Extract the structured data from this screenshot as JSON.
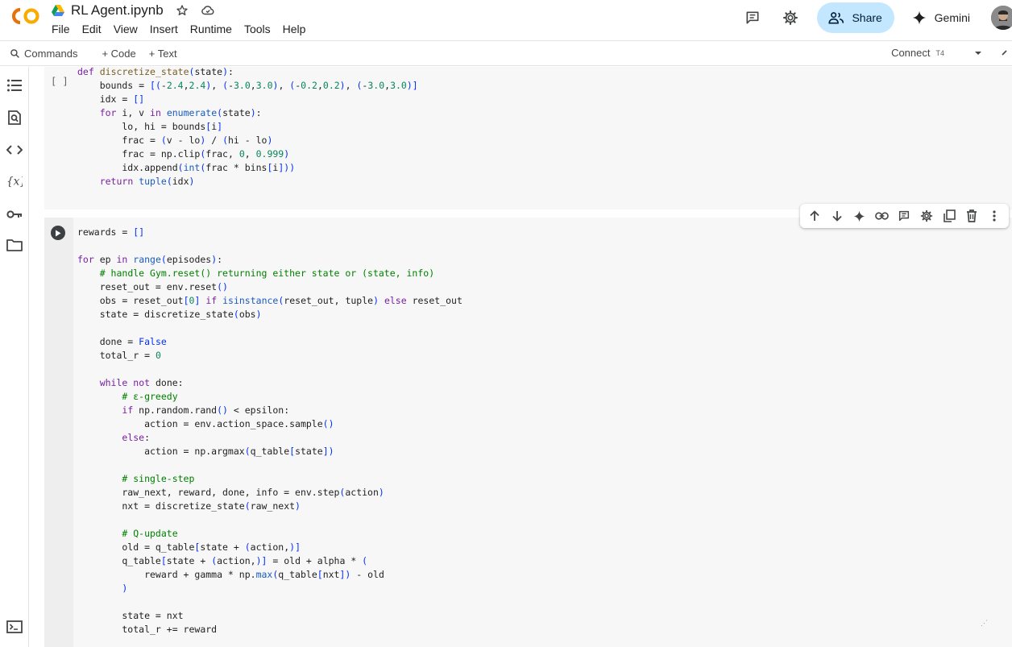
{
  "header": {
    "logo_text": "CO",
    "notebook_title": "RL Agent.ipynb",
    "menu": [
      "File",
      "Edit",
      "View",
      "Insert",
      "Runtime",
      "Tools",
      "Help"
    ],
    "share_label": "Share",
    "gemini_label": "Gemini"
  },
  "toolbar": {
    "commands_label": "Commands",
    "add_code_label": "+ Code",
    "add_text_label": "+ Text",
    "connect_label": "Connect",
    "runtime_badge": "T4"
  },
  "cells": [
    {
      "execution_count": "[ ]",
      "code": [
        "def discretize_state(state):",
        "    bounds = [(-2.4,2.4), (-3.0,3.0), (-0.2,0.2), (-3.0,3.0)]",
        "    idx = []",
        "    for i, v in enumerate(state):",
        "        lo, hi = bounds[i]",
        "        frac = (v - lo) / (hi - lo)",
        "        frac = np.clip(frac, 0, 0.999)",
        "        idx.append(int(frac * bins[i]))",
        "    return tuple(idx)"
      ]
    },
    {
      "execution_count": "",
      "code": [
        "rewards = []",
        "",
        "for ep in range(episodes):",
        "    # handle Gym.reset() returning either state or (state, info)",
        "    reset_out = env.reset()",
        "    obs = reset_out[0] if isinstance(reset_out, tuple) else reset_out",
        "    state = discretize_state(obs)",
        "",
        "    done = False",
        "    total_r = 0",
        "",
        "    while not done:",
        "        # ε-greedy",
        "        if np.random.rand() < epsilon:",
        "            action = env.action_space.sample()",
        "        else:",
        "            action = np.argmax(q_table[state])",
        "",
        "        # single-step",
        "        raw_next, reward, done, info = env.step(action)",
        "        nxt = discretize_state(raw_next)",
        "",
        "        # Q-update",
        "        old = q_table[state + (action,)]",
        "        q_table[state + (action,)] = old + alpha * (",
        "            reward + gamma * np.max(q_table[nxt]) - old",
        "        )",
        "",
        "        state = nxt",
        "        total_r += reward"
      ]
    }
  ],
  "colors": {
    "share_bg": "#c2e7ff",
    "logo_orange": "#f9ab00",
    "logo_orange_dark": "#e8710a",
    "keyword": "#7a1fa2",
    "comment": "#008000",
    "number": "#098658"
  }
}
